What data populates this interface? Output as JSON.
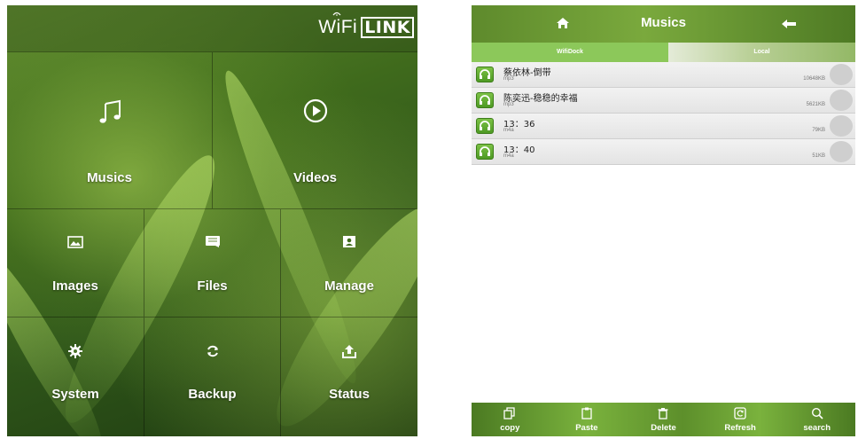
{
  "left_panel": {
    "logo": {
      "wifi_text": "WiFi",
      "link_text": "LINK"
    },
    "tiles": [
      {
        "label": "Musics",
        "icon": "music-note-icon"
      },
      {
        "label": "Videos",
        "icon": "play-circle-icon"
      },
      {
        "label": "Images",
        "icon": "image-icon"
      },
      {
        "label": "Files",
        "icon": "file-icon"
      },
      {
        "label": "Manage",
        "icon": "contact-card-icon"
      },
      {
        "label": "System",
        "icon": "gear-icon"
      },
      {
        "label": "Backup",
        "icon": "sync-icon"
      },
      {
        "label": "Status",
        "icon": "upload-icon"
      }
    ]
  },
  "right_panel": {
    "header": {
      "title": "Musics",
      "home_icon": "home-icon",
      "back_icon": "back-arrow-icon"
    },
    "tabs": [
      {
        "label": "WifiDock",
        "active": true
      },
      {
        "label": "Local",
        "active": false
      }
    ],
    "files": [
      {
        "name": "蔡依林-倒带",
        "type": "mp3",
        "size": "10648KB"
      },
      {
        "name": "陈奕迅-稳稳的幸福",
        "type": "mp3",
        "size": "5621KB"
      },
      {
        "name": "13：36",
        "type": "m4a",
        "size": "79KB"
      },
      {
        "name": "13：40",
        "type": "m4a",
        "size": "51KB"
      }
    ],
    "toolbar": [
      {
        "label": "copy",
        "icon": "copy-icon"
      },
      {
        "label": "Paste",
        "icon": "paste-icon"
      },
      {
        "label": "Delete",
        "icon": "trash-icon"
      },
      {
        "label": "Refresh",
        "icon": "refresh-icon"
      },
      {
        "label": "search",
        "icon": "search-icon"
      }
    ]
  },
  "colors": {
    "accent_green": "#7ab23d",
    "dark_green": "#3f6a1c",
    "row_bg": "#e8e8e8"
  }
}
